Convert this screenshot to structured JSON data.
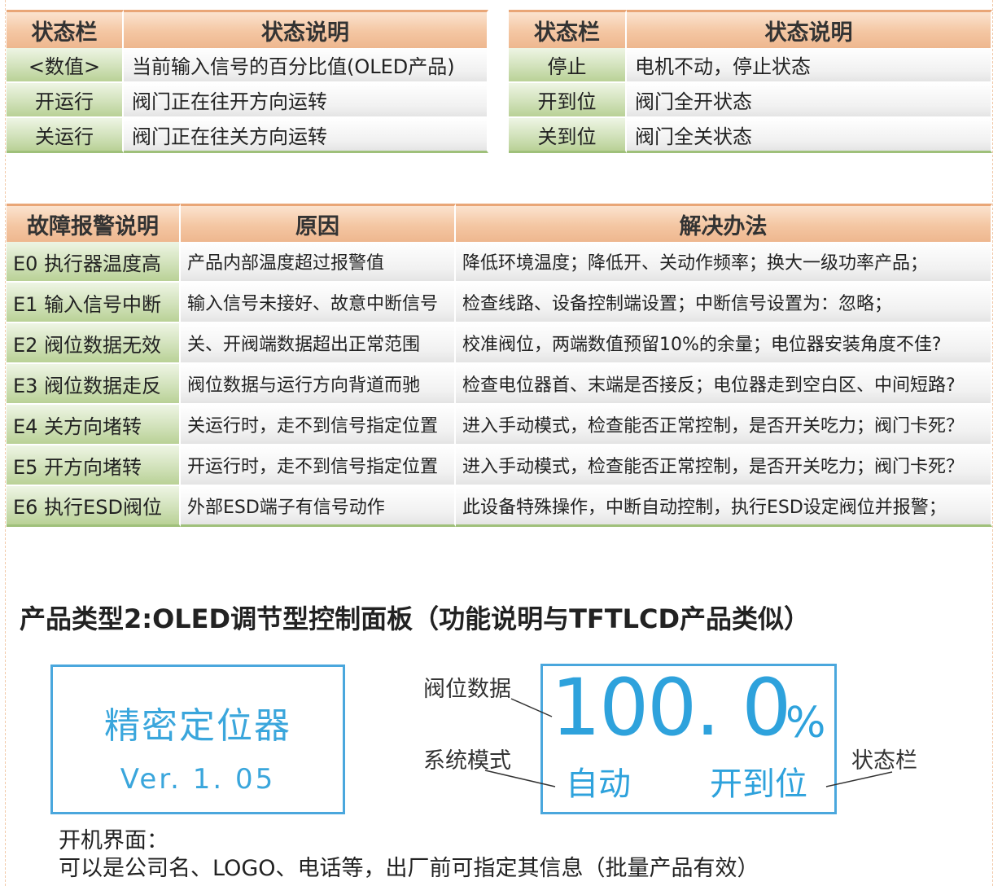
{
  "status_table": {
    "headers": [
      "状态栏",
      "状态说明"
    ],
    "left_rows": [
      [
        "<数值>",
        "当前输入信号的百分比值(OLED产品)"
      ],
      [
        "开运行",
        "阀门正在往开方向运转"
      ],
      [
        "关运行",
        "阀门正在往关方向运转"
      ]
    ],
    "right_rows": [
      [
        "停止",
        "电机不动，停止状态"
      ],
      [
        "开到位",
        "阀门全开状态"
      ],
      [
        "关到位",
        "阀门全关状态"
      ]
    ]
  },
  "fault_table": {
    "headers": [
      "故障报警说明",
      "原因",
      "解决办法"
    ],
    "rows": [
      [
        "E0 执行器温度高",
        "产品内部温度超过报警值",
        "降低环境温度；降低开、关动作频率；换大一级功率产品；"
      ],
      [
        "E1 输入信号中断",
        "输入信号未接好、故意中断信号",
        "检查线路、设备控制端设置；中断信号设置为：忽略；"
      ],
      [
        "E2 阀位数据无效",
        "关、开阀端数据超出正常范围",
        "校准阀位，两端数值预留10%的余量；电位器安装角度不佳?"
      ],
      [
        "E3 阀位数据走反",
        "阀位数据与运行方向背道而驰",
        "检查电位器首、末端是否接反；电位器走到空白区、中间短路?"
      ],
      [
        "E4 关方向堵转",
        "关运行时，走不到信号指定位置",
        "进入手动模式，检查能否正常控制，是否开关吃力；阀门卡死？"
      ],
      [
        "E5 开方向堵转",
        "开运行时，走不到信号指定位置",
        "进入手动模式，检查能否正常控制，是否开关吃力；阀门卡死？"
      ],
      [
        "E6 执行ESD阀位",
        "外部ESD端子有信号动作",
        "此设备特殊操作，中断自动控制，执行ESD设定阀位并报警；"
      ]
    ]
  },
  "section_title": "产品类型2:OLED调节型控制面板（功能说明与TFTLCD产品类似）",
  "boot_screen": {
    "name": "精密定位器",
    "version": "Ver. 1. 05"
  },
  "main_display": {
    "value": "100. 0",
    "unit": "%",
    "mode": "自动",
    "status": "开到位"
  },
  "callouts": {
    "valve_data": "阀位数据",
    "system_mode": "系统模式",
    "status_bar": "状态栏"
  },
  "boot_caption": {
    "line1": "开机界面：",
    "line2": "可以是公司名、LOGO、电话等，出厂前可指定其信息（批量产品有效）"
  },
  "colors": {
    "header_orange": "#f4c6a2",
    "label_green": "#cfe0b7",
    "display_blue": "#2ea2dc"
  }
}
